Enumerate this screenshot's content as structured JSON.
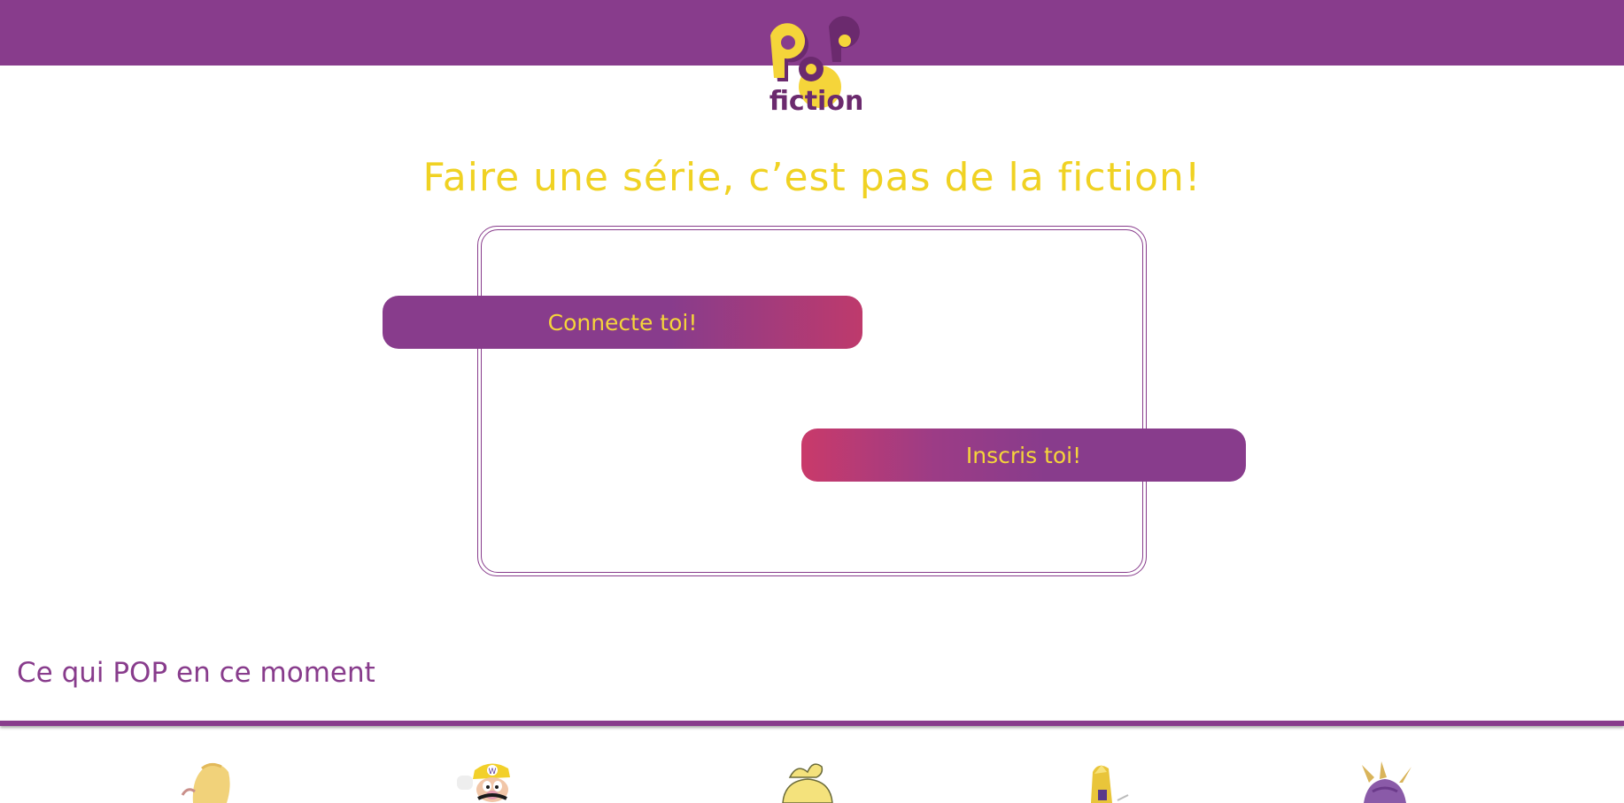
{
  "header": {
    "logo_top": "PoP",
    "logo_bottom": "fiction",
    "bar_color": "#883c8c",
    "logo_colors": [
      "#f5d53a",
      "#6b2a6e"
    ]
  },
  "hero": {
    "tagline": "Faire une série, c’est pas de la fiction!",
    "tagline_color": "#f0d223"
  },
  "auth": {
    "login_label": "Connecte toi!",
    "signup_label": "Inscris toi!"
  },
  "trending": {
    "title": "Ce qui POP en ce moment",
    "items": [
      {
        "name": "rapunzel-thumbnail"
      },
      {
        "name": "wario-thumbnail"
      },
      {
        "name": "yellow-character-thumbnail"
      },
      {
        "name": "golden-helmet-thumbnail"
      },
      {
        "name": "spyro-thumbnail"
      }
    ]
  }
}
